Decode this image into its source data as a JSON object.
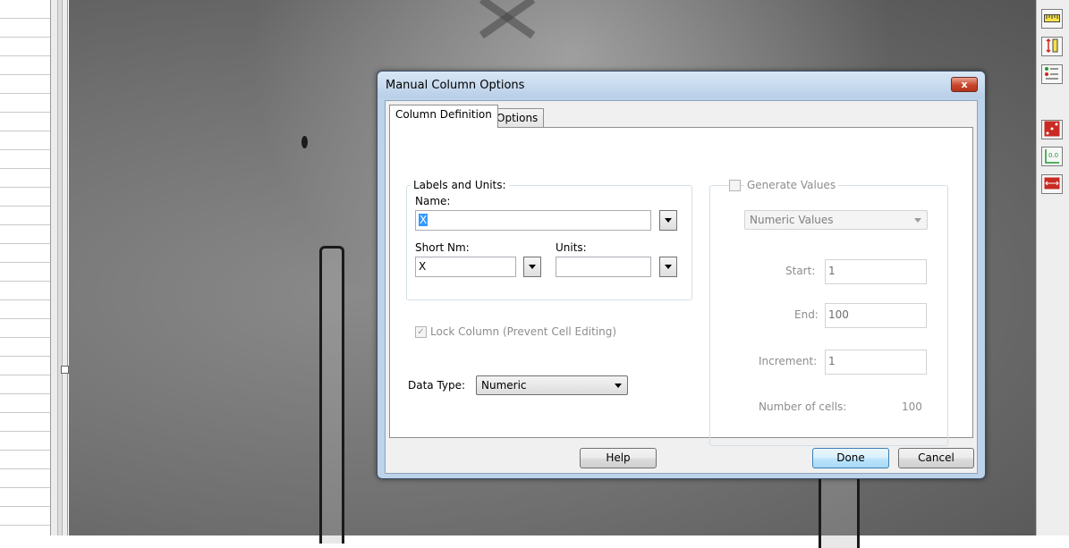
{
  "dialog": {
    "title": "Manual Column Options",
    "close_label": "x",
    "tabs": [
      {
        "label": "Column Definition",
        "active": true
      },
      {
        "label": "Options",
        "active": false
      }
    ],
    "labels_units": {
      "group_label": "Labels and Units:",
      "name_label": "Name:",
      "name_value": "X",
      "short_name_label": "Short Nm:",
      "short_name_value": "X",
      "units_label": "Units:",
      "units_value": ""
    },
    "lock_column": {
      "label": "Lock Column (Prevent Cell Editing)",
      "checked": true,
      "enabled": false
    },
    "data_type": {
      "label": "Data Type:",
      "value": "Numeric"
    },
    "generate_values": {
      "label": "Generate Values",
      "checked": false,
      "mode": "Numeric Values",
      "start_label": "Start:",
      "start_value": "1",
      "end_label": "End:",
      "end_value": "100",
      "increment_label": "Increment:",
      "increment_value": "1",
      "num_cells_label": "Number of cells:",
      "num_cells_value": "100"
    },
    "buttons": {
      "help": "Help",
      "done": "Done",
      "cancel": "Cancel"
    }
  },
  "toolbar": {
    "icons": [
      "ruler-icon",
      "vertical-measure-icon",
      "list-settings-icon",
      "scatter-points-icon",
      "origin-axis-icon",
      "horizontal-measure-icon"
    ],
    "origin_label": "0.0"
  },
  "colors": {
    "dialog_frame": "#bcd3ea",
    "close_button": "#c8462c",
    "selection": "#3399ff"
  }
}
